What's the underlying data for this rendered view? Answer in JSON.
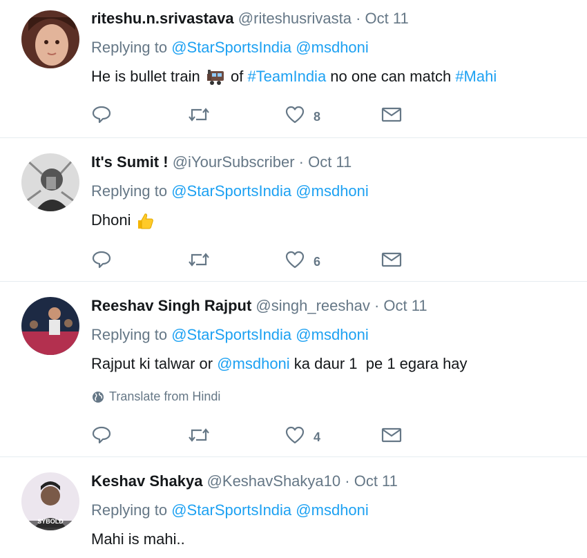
{
  "tweets": [
    {
      "name": "riteshu.n.srivastava",
      "handle": "@riteshusrivasta",
      "sep": " · ",
      "time": "Oct 11",
      "replying_prefix": "Replying to ",
      "mention1": "@StarSportsIndia",
      "mention2": "@msdhoni",
      "text_parts": [
        "He is bullet train ",
        " of ",
        "#TeamIndia",
        " no one can match ",
        "#Mahi"
      ],
      "likes": "8",
      "avatar_color": "#6b3b2e"
    },
    {
      "name": "It's Sumit !",
      "handle": "@iYourSubscriber",
      "sep": " · ",
      "time": "Oct 11",
      "replying_prefix": "Replying to ",
      "mention1": "@StarSportsIndia",
      "mention2": "@msdhoni",
      "text_parts": [
        "Dhoni "
      ],
      "likes": "6",
      "avatar_color": "#3a3a3a"
    },
    {
      "name": "Reeshav Singh Rajput",
      "handle": "@singh_reeshav",
      "sep": " · ",
      "time": "Oct 11",
      "replying_prefix": "Replying to ",
      "mention1": "@StarSportsIndia",
      "mention2": "@msdhoni",
      "text_parts": [
        "Rajput ki talwar or ",
        "@msdhoni",
        " ka daur 1  pe 1 egara hay"
      ],
      "translate": "Translate from Hindi",
      "likes": "4",
      "avatar_color": "#2b3b5a"
    },
    {
      "name": "Keshav Shakya",
      "handle": "@KeshavShakya10",
      "sep": " · ",
      "time": "Oct 11",
      "replying_prefix": "Replying to ",
      "mention1": "@StarSportsIndia",
      "mention2": "@msdhoni",
      "text_parts": [
        "Mahi is mahi.."
      ],
      "avatar_caption": "SYBOLD",
      "avatar_color": "#e9e4ea"
    }
  ],
  "icons": {
    "reply": "reply-icon",
    "retweet": "retweet-icon",
    "like": "heart-icon",
    "dm": "envelope-icon",
    "globe": "globe-icon",
    "train": "train-emoji-icon",
    "thumbs": "thumbs-up-emoji-icon"
  },
  "colors": {
    "link": "#1da1f2",
    "muted": "#657786",
    "text": "#14171a",
    "divider": "#e6ecf0"
  }
}
